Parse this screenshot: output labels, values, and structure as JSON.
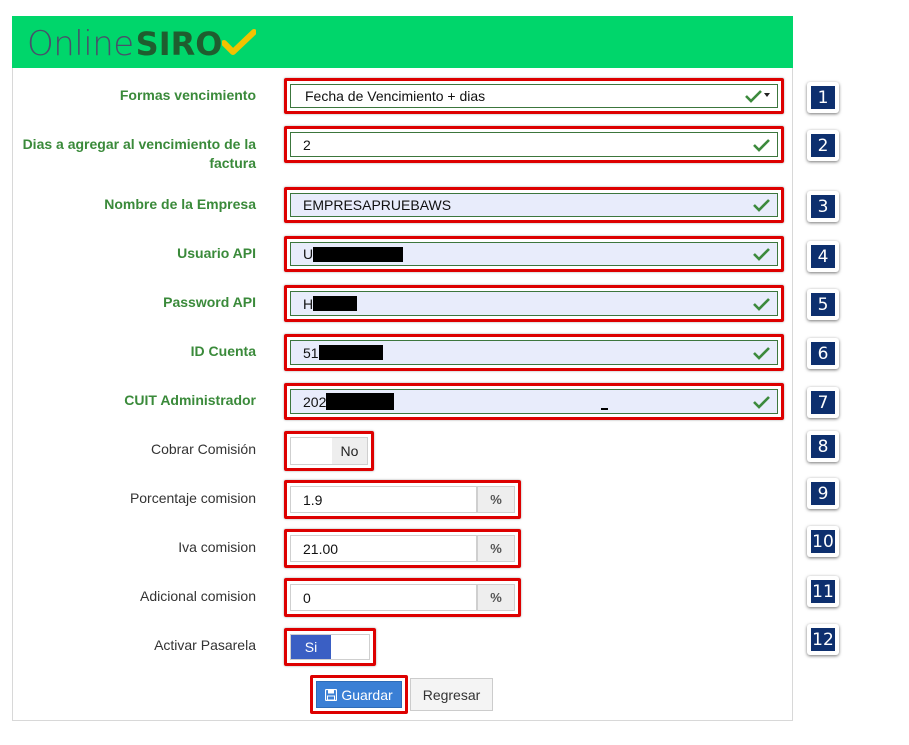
{
  "brand": {
    "part1": "Online",
    "part2": "SIRO"
  },
  "fields": [
    {
      "label": "Formas vencimiento",
      "value": "Fecha de Vencimiento + dias",
      "badge": "1"
    },
    {
      "label": "Dias a agregar al vencimiento de la factura",
      "value": "2",
      "badge": "2"
    },
    {
      "label": "Nombre de la Empresa",
      "value": "EMPRESAPRUEBAWS",
      "badge": "3"
    },
    {
      "label": "Usuario API",
      "value": "U",
      "badge": "4"
    },
    {
      "label": "Password API",
      "value": "H",
      "badge": "5"
    },
    {
      "label": "ID Cuenta",
      "value": "51",
      "badge": "6"
    },
    {
      "label": "CUIT Administrador",
      "value": "202",
      "badge": "7"
    }
  ],
  "toggles": [
    {
      "label": "Cobrar Comisión",
      "state": "No",
      "badge": "8"
    },
    {
      "label": "Activar Pasarela",
      "state": "Si",
      "badge": "12"
    }
  ],
  "percent_fields": [
    {
      "label": "Porcentaje comision",
      "value": "1.9",
      "unit": "%",
      "badge": "9"
    },
    {
      "label": "Iva comision",
      "value": "21.00",
      "unit": "%",
      "badge": "10"
    },
    {
      "label": "Adicional comision",
      "value": "0",
      "unit": "%",
      "badge": "11"
    }
  ],
  "buttons": {
    "save": "Guardar",
    "back": "Regresar"
  },
  "colors": {
    "header": "#00d66b",
    "label_green": "#3a8a3a",
    "highlight": "#dd0000",
    "badge": "#0d2f6e",
    "primary": "#3a7fd5"
  }
}
